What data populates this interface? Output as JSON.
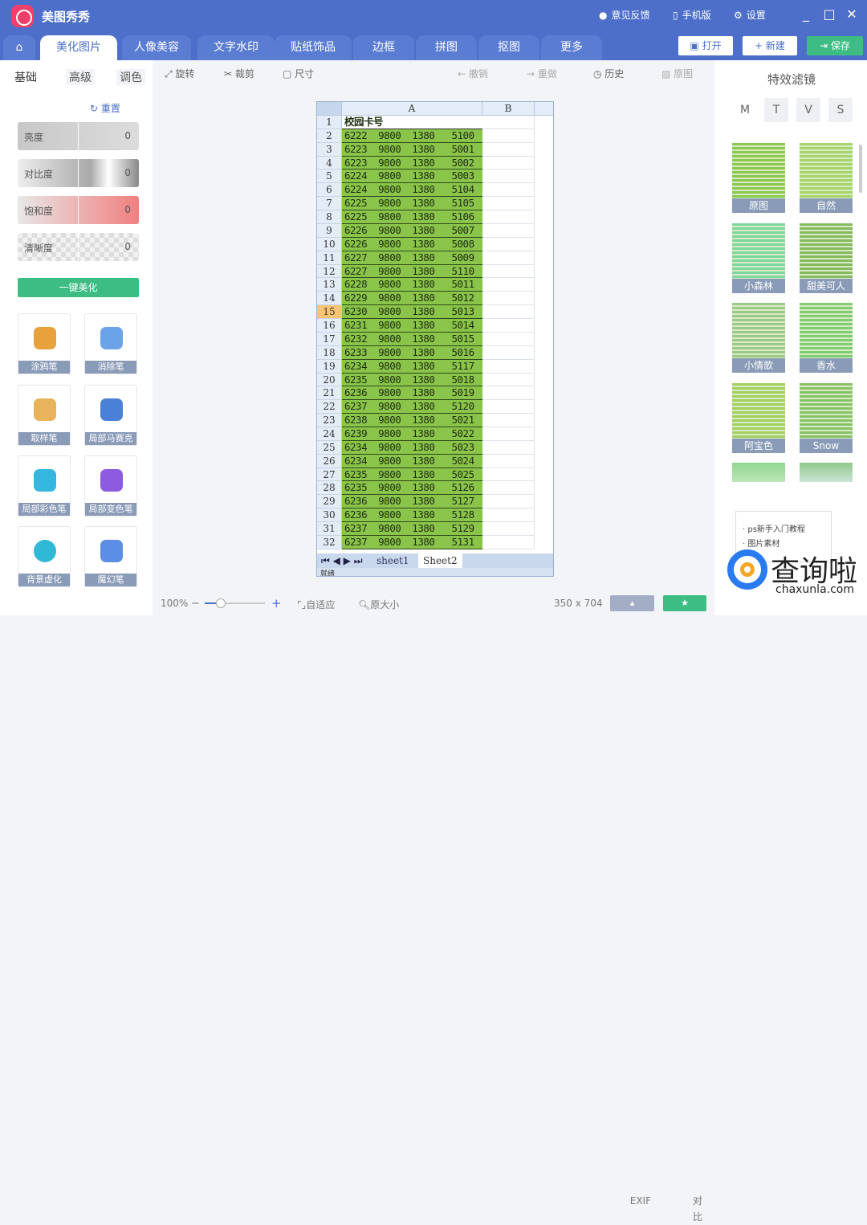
{
  "app": {
    "name": "美图秀秀",
    "links": [
      "意见反馈",
      "手机版",
      "设置"
    ]
  },
  "tabs": [
    "美化图片",
    "人像美容",
    "文字水印",
    "贴纸饰品",
    "边框",
    "拼图",
    "抠图",
    "更多"
  ],
  "actions": {
    "open": "打开",
    "new": "新建",
    "save": "保存"
  },
  "left": {
    "subtabs": [
      "基础",
      "高级",
      "调色"
    ],
    "reset": "重置",
    "sliders": [
      {
        "label": "亮度",
        "value": "0"
      },
      {
        "label": "对比度",
        "value": "0"
      },
      {
        "label": "饱和度",
        "value": "0"
      },
      {
        "label": "清晰度",
        "value": "0"
      }
    ],
    "auto": "一键美化",
    "tools": [
      "涂鸦笔",
      "消除笔",
      "取样笔",
      "局部马赛克",
      "局部彩色笔",
      "局部变色笔",
      "背景虚化",
      "魔幻笔"
    ]
  },
  "toolbar": {
    "rotate": "旋转",
    "crop": "裁剪",
    "size": "尺寸",
    "undo": "撤销",
    "redo": "重做",
    "history": "历史",
    "original": "原图"
  },
  "sheet": {
    "col_a": "A",
    "col_b": "B",
    "header": "校园卡号",
    "selected_row": 15,
    "rows": [
      "6222  9800  1380   5100",
      "6223  9800  1380   5001",
      "6223  9800  1380   5002",
      "6224  9800  1380   5003",
      "6224  9800  1380   5104",
      "6225  9800  1380   5105",
      "6225  9800  1380   5106",
      "6226  9800  1380   5007",
      "6226  9800  1380   5008",
      "6227  9800  1380   5009",
      "6227  9800  1380   5110",
      "6228  9800  1380   5011",
      "6229  9800  1380   5012",
      "6230  9800  1380   5013",
      "6231  9800  1380   5014",
      "6232  9800  1380   5015",
      "6233  9800  1380   5016",
      "6234  9800  1380   5117",
      "6235  9800  1380   5018",
      "6236  9800  1380   5019",
      "6237  9800  1380   5120",
      "6238  9800  1380   5021",
      "6239  9800  1380   5022",
      "6234  9800  1380   5023",
      "6234  9800  1380   5024",
      "6235  9800  1380   5025",
      "6235  9800  1380   5126",
      "6236  9800  1380   5127",
      "6236  9800  1380   5128",
      "6237  9800  1380   5129",
      "6237  9800  1380   5131"
    ],
    "sheets": [
      "sheet1",
      "Sheet2"
    ],
    "status": "就绪"
  },
  "right": {
    "title": "特效滤镜",
    "modes": [
      "M",
      "T",
      "V",
      "S"
    ],
    "filters": [
      "原图",
      "自然",
      "小森林",
      "甜美可人",
      "小情歌",
      "香水",
      "阿宝色",
      "Snow"
    ],
    "ad": [
      "ps新手入门教程",
      "图片素材"
    ]
  },
  "bottom": {
    "zoom": "100%",
    "fit": "自适应",
    "actual": "原大小",
    "dims": "350 x 704",
    "exif": "EXIF",
    "compare": "对比"
  },
  "watermark": {
    "text": "查询啦",
    "url": "chaxunla.com"
  }
}
